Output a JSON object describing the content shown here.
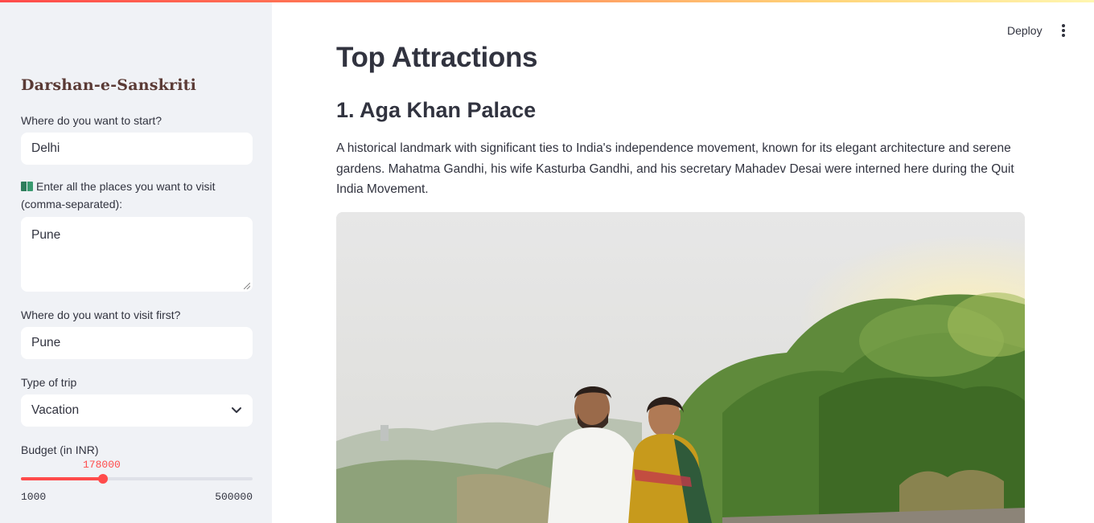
{
  "sidebar": {
    "title": "Darshan-e-Sanskriti",
    "start": {
      "label": "Where do you want to start?",
      "value": "Delhi"
    },
    "places": {
      "label": "Enter all the places you want to visit (comma-separated):",
      "icon": "book-icon",
      "value": "Pune"
    },
    "first_visit": {
      "label": "Where do you want to visit first?",
      "value": "Pune"
    },
    "trip_type": {
      "label": "Type of trip",
      "value": "Vacation"
    },
    "budget": {
      "label": "Budget (in INR)",
      "value": "178000",
      "min": "1000",
      "max": "500000",
      "accent": "#ff4b4b"
    }
  },
  "header": {
    "deploy_label": "Deploy"
  },
  "main": {
    "title": "Top Attractions",
    "attraction": {
      "heading": "1. Aga Khan Palace",
      "description": "A historical landmark with significant ties to India's independence movement, known for its elegant architecture and serene gardens. Mahatma Gandhi, his wife Kasturba Gandhi, and his secretary Mahadev Desai were interned here during the Quit India Movement."
    }
  }
}
